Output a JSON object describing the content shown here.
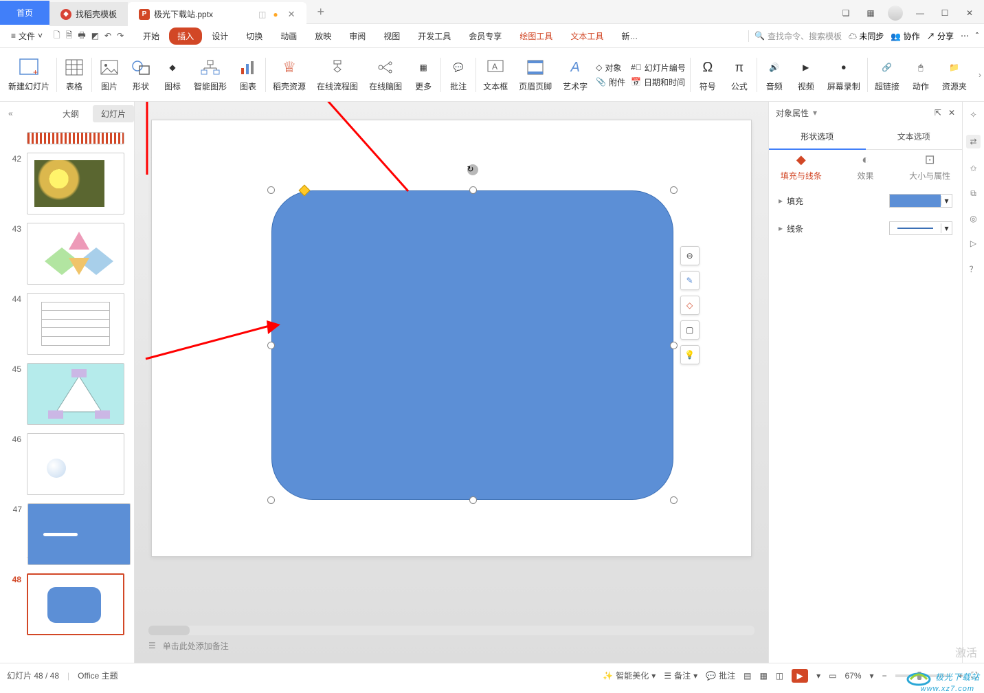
{
  "titlebar": {
    "home": "首页",
    "dk_tab": "找稻壳模板",
    "file_tab": "极光下载站.pptx",
    "new_tab": "+"
  },
  "menubar": {
    "file": "文件",
    "tabs": [
      "开始",
      "插入",
      "设计",
      "切换",
      "动画",
      "放映",
      "审阅",
      "视图",
      "开发工具",
      "会员专享"
    ],
    "tool_tabs": [
      "绘图工具",
      "文本工具"
    ],
    "extra": "新…",
    "search_placeholder": "查找命令、搜索模板",
    "unsync": "未同步",
    "collab": "协作",
    "share": "分享"
  },
  "ribbon": {
    "items": [
      "新建幻灯片",
      "表格",
      "图片",
      "形状",
      "图标",
      "智能图形",
      "图表",
      "稻壳资源",
      "在线流程图",
      "在线脑图",
      "更多",
      "批注",
      "文本框",
      "页眉页脚",
      "艺术字"
    ],
    "small": {
      "obj": "对象",
      "att": "附件",
      "slidenum": "幻灯片编号",
      "datetime": "日期和时间"
    },
    "right": [
      "符号",
      "公式",
      "音频",
      "视频",
      "屏幕录制",
      "超链接",
      "动作",
      "资源夹"
    ]
  },
  "sidebar": {
    "outline": "大纲",
    "slides": "幻灯片",
    "nums": [
      "42",
      "43",
      "44",
      "45",
      "46",
      "47",
      "48"
    ]
  },
  "canvas": {
    "notes_placeholder": "单击此处添加备注"
  },
  "panel": {
    "title": "对象属性",
    "tabs": [
      "形状选项",
      "文本选项"
    ],
    "subtabs": [
      "填充与线条",
      "效果",
      "大小与属性"
    ],
    "fill": "填充",
    "line": "线条"
  },
  "status": {
    "page": "幻灯片 48 / 48",
    "theme": "Office 主题",
    "beauty": "智能美化",
    "notes": "备注",
    "comments": "批注",
    "zoom": "67%",
    "activate": "激活"
  },
  "watermark": {
    "name": "极光下载站",
    "url": "www.xz7.com"
  }
}
